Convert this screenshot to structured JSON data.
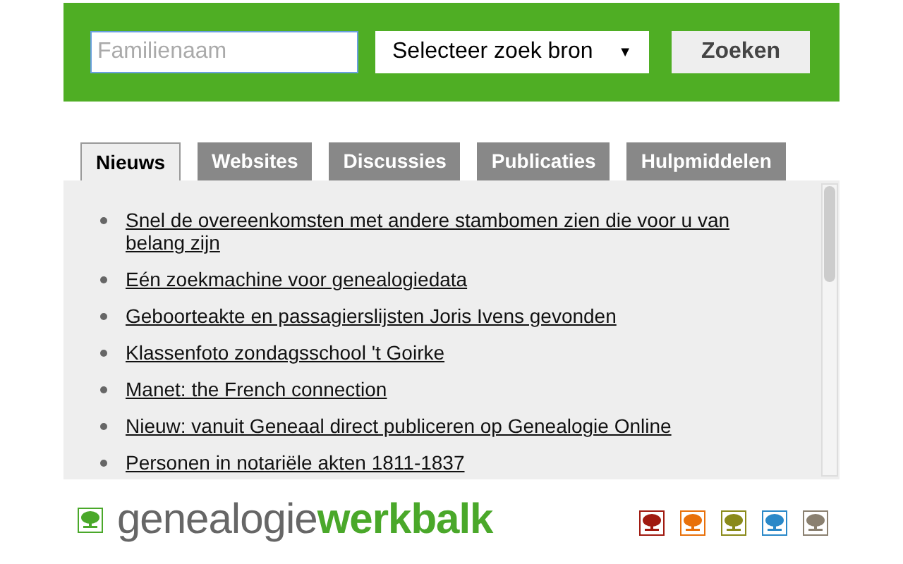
{
  "search": {
    "placeholder": "Familienaam",
    "source_select": "Selecteer zoek bron",
    "dropdown_arrow": "▼",
    "button": "Zoeken"
  },
  "tabs": [
    {
      "label": "Nieuws",
      "selected": true
    },
    {
      "label": "Websites",
      "selected": false
    },
    {
      "label": "Discussies",
      "selected": false
    },
    {
      "label": "Publicaties",
      "selected": false
    },
    {
      "label": "Hulpmiddelen",
      "selected": false
    }
  ],
  "news": [
    "Snel de overeenkomsten met andere stambomen zien die voor u van belang zijn",
    "Eén zoekmachine voor genealogiedata",
    "Geboorteakte en passagierslijsten Joris Ivens gevonden",
    "Klassenfoto zondagsschool 't Goirke",
    "Manet: the French connection",
    "Nieuw: vanuit Geneaal direct publiceren op Genealogie Online",
    "Personen in notariële akten 1811-1837"
  ],
  "footer": {
    "logo_part1": "genealogie",
    "logo_part2": "werkbalk",
    "themes": [
      {
        "color": "#a01a10"
      },
      {
        "color": "#e8700a"
      },
      {
        "color": "#8a8a1a"
      },
      {
        "color": "#2a88c8"
      },
      {
        "color": "#8a8070"
      }
    ]
  }
}
